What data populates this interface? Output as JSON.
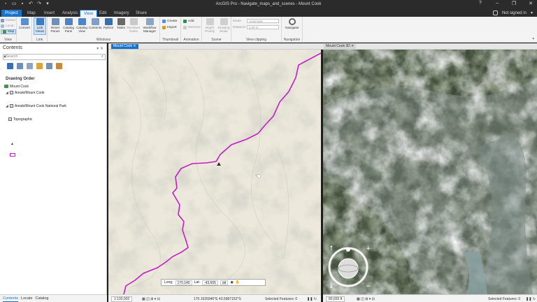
{
  "app": {
    "title": "ArcGIS Pro - Navigate_maps_and_scenes - Mount Cook",
    "signin": "Not signed in",
    "help": "?"
  },
  "tabs": [
    {
      "label": "Project"
    },
    {
      "label": "Map"
    },
    {
      "label": "Insert"
    },
    {
      "label": "Analysis"
    },
    {
      "label": "View"
    },
    {
      "label": "Edit"
    },
    {
      "label": "Imagery"
    },
    {
      "label": "Share"
    }
  ],
  "ribbon": {
    "view_group": {
      "label": "View",
      "global": "Global",
      "local": "Local",
      "map": "Map",
      "convert": "Convert"
    },
    "link_group": {
      "label": "Link",
      "link_views": "Link Views"
    },
    "windows_group": {
      "label": "Windows",
      "reset_panes": "Reset Panes",
      "catalog_pane": "Catalog Pane",
      "catalog_view": "Catalog View",
      "contents": "Contents",
      "python": "Python",
      "tasks": "Tasks",
      "geoprocessing": "Reviewer Rules",
      "workflow": "Workflow Manager"
    },
    "thumbnail_group": {
      "label": "Thumbnail",
      "create": "Create",
      "import": "Import"
    },
    "animation_group": {
      "label": "Animation",
      "add": "Add",
      "remove": "Remove"
    },
    "scene_group": {
      "label": "Scene",
      "depth_priority": "Depth Priority",
      "drawing_mode": "Drawing Mode"
    },
    "clipping_group": {
      "label": "View clipping",
      "mode_label": "Mode",
      "mode_value": "Automatic",
      "distance_label": "Distance",
      "distance_value": "0.00 m"
    },
    "navigation_group": {
      "label": "Navigation",
      "navigator": "Navigator"
    }
  },
  "contents": {
    "title": "Contents",
    "search_placeholder": "Search",
    "section": "Drawing Order",
    "nodes": [
      {
        "label": "Mount Cook"
      },
      {
        "label": "Aoraki/Mount Cook"
      },
      {
        "label": "Aoraki/Mount Cook National Park"
      },
      {
        "label": "Topographic"
      }
    ],
    "bottom_tabs": [
      "Contents",
      "Locate",
      "Catalog"
    ]
  },
  "views": {
    "map_tab": "Mount Cook",
    "scene_tab": "Mount Cook 3D"
  },
  "status": {
    "scale_2d": "1:100,000",
    "coords_2d": "170.1635946°E 43.5987152°S",
    "selected_2d": "Selected Features: 0",
    "scale_3d": "80,655 ft",
    "selected_3d": "Selected Features: 0"
  },
  "coord_popup": {
    "long_label": "Long:",
    "long_value": "170.140",
    "lat_label": "Lat:",
    "lat_value": "-43.605",
    "unit": "dd"
  },
  "colors": {
    "accent": "#1a73c9",
    "boundary": "#c21fc4"
  }
}
